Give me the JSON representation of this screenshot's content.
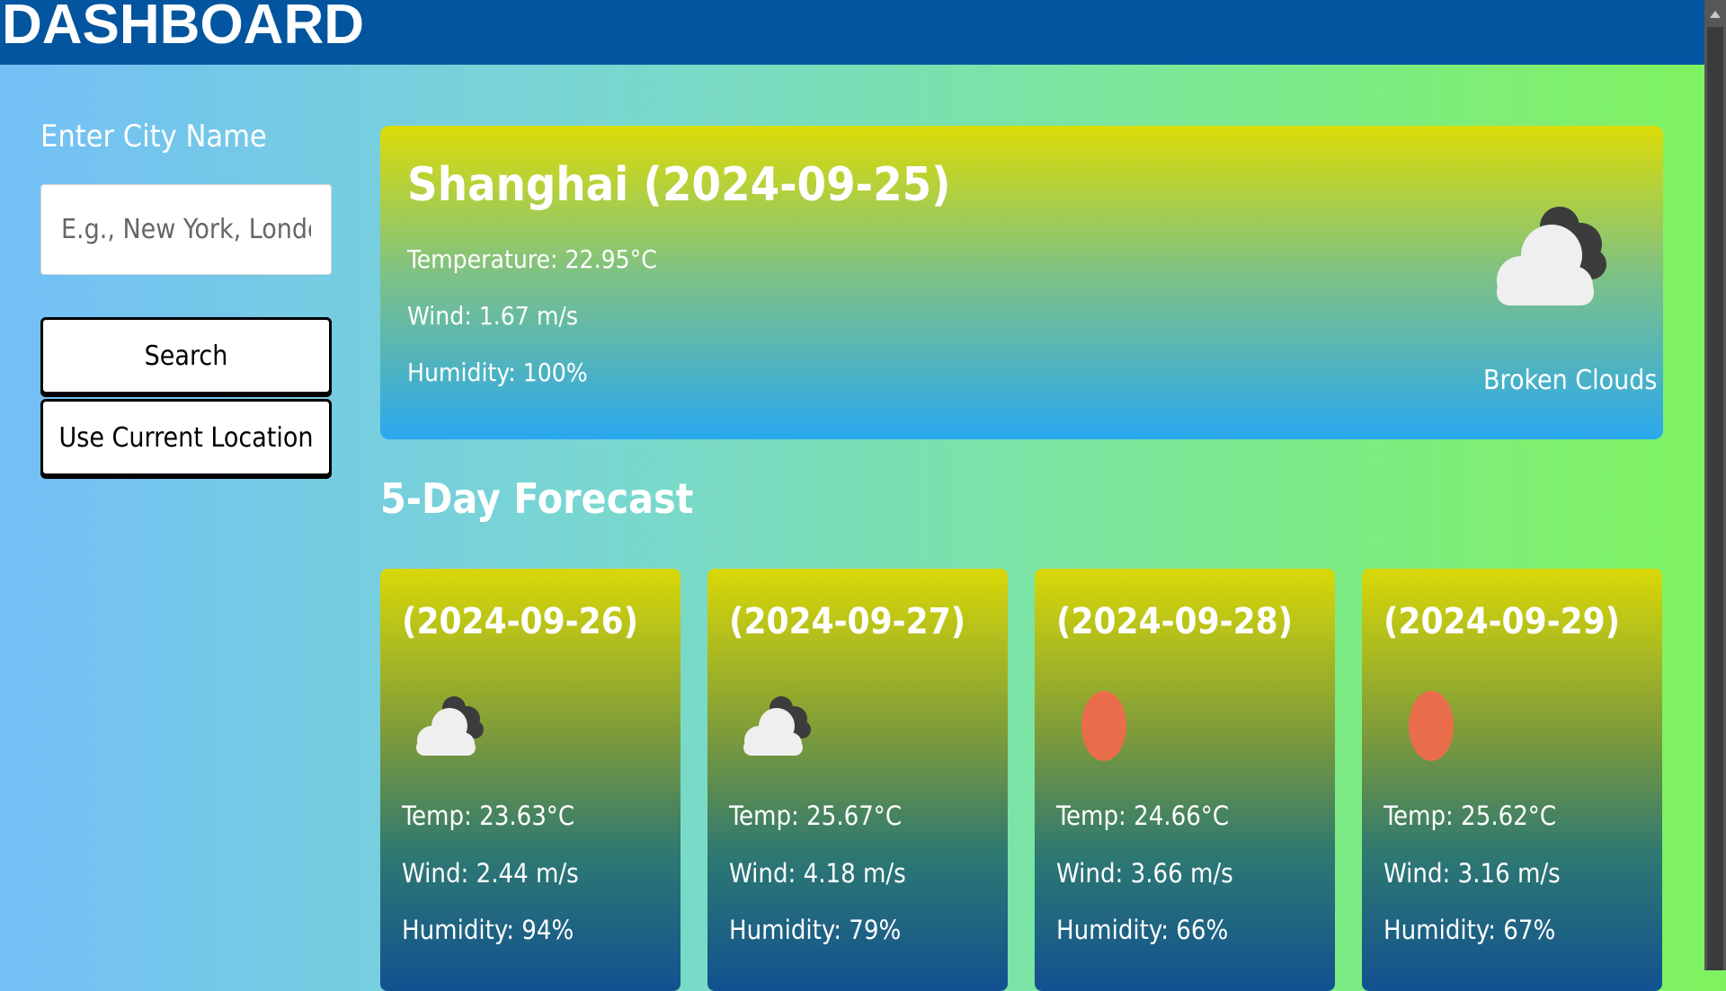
{
  "header": {
    "title": "DASHBOARD"
  },
  "sidebar": {
    "city_label": "Enter City Name",
    "input_placeholder": "E.g., New York, London, Tokyo",
    "input_value": "",
    "search_label": "Search",
    "location_label": "Use Current Location"
  },
  "current": {
    "title": "Shanghai (2024-09-25)",
    "temperature": "Temperature: 22.95°C",
    "wind": "Wind: 1.67 m/s",
    "humidity": "Humidity: 100%",
    "description": "Broken Clouds",
    "icon": "broken-clouds-icon"
  },
  "forecast": {
    "heading": "5-Day Forecast",
    "days": [
      {
        "date": "(2024-09-26)",
        "icon": "broken-clouds-icon",
        "temp": "Temp: 23.63°C",
        "wind": "Wind: 2.44 m/s",
        "humidity": "Humidity: 94%"
      },
      {
        "date": "(2024-09-27)",
        "icon": "broken-clouds-icon",
        "temp": "Temp: 25.67°C",
        "wind": "Wind: 4.18 m/s",
        "humidity": "Humidity: 79%"
      },
      {
        "date": "(2024-09-28)",
        "icon": "clear-sky-icon",
        "temp": "Temp: 24.66°C",
        "wind": "Wind: 3.66 m/s",
        "humidity": "Humidity: 66%"
      },
      {
        "date": "(2024-09-29)",
        "icon": "clear-sky-icon",
        "temp": "Temp: 25.62°C",
        "wind": "Wind: 3.16 m/s",
        "humidity": "Humidity: 67%"
      }
    ]
  },
  "colors": {
    "header_bg": "#02559e",
    "sun": "#ea6d4b",
    "cloud_dark": "#3c3c3c",
    "cloud_light": "#efefef"
  }
}
